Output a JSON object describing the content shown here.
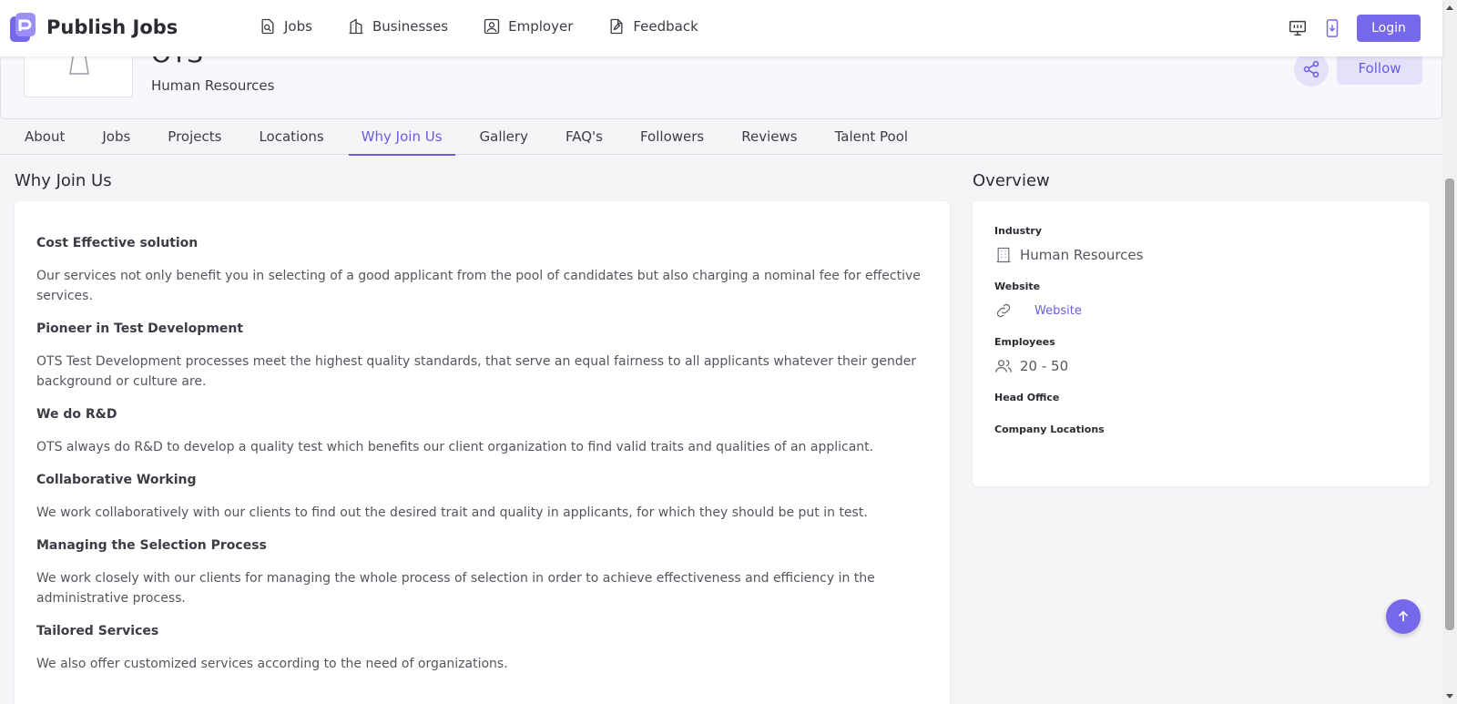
{
  "navbar": {
    "brand": "Publish Jobs",
    "links": [
      {
        "label": "Jobs",
        "icon": "job-search-icon"
      },
      {
        "label": "Businesses",
        "icon": "building-icon"
      },
      {
        "label": "Employer",
        "icon": "employer-icon"
      },
      {
        "label": "Feedback",
        "icon": "feedback-icon"
      }
    ],
    "icons": [
      "desktop-icon",
      "mobile-download-icon"
    ],
    "login_label": "Login"
  },
  "company": {
    "name": "OTS",
    "industry": "Human Resources",
    "follow_label": "Follow",
    "share_icon": "share-icon"
  },
  "tabs": [
    "About",
    "Jobs",
    "Projects",
    "Locations",
    "Why Join Us",
    "Gallery",
    "FAQ's",
    "Followers",
    "Reviews",
    "Talent Pool"
  ],
  "active_tab": "Why Join Us",
  "why_join": {
    "title": "Why Join Us",
    "items": [
      {
        "heading": "Cost Effective solution",
        "text": "Our services not only benefit you in selecting of a good applicant from the pool of candidates but also charging a nominal fee for effective services."
      },
      {
        "heading": "Pioneer in Test Development",
        "text": "OTS Test Development processes meet the highest quality standards, that serve an equal fairness to all applicants whatever their gender background or culture are."
      },
      {
        "heading": "We do R&D",
        "text": "OTS always do R&D to develop a quality test which benefits our client organization to find valid traits and qualities of an applicant."
      },
      {
        "heading": "Collaborative Working",
        "text": "We work collaboratively with our clients to find out the desired trait and quality in applicants, for which they should be put in test."
      },
      {
        "heading": "Managing the Selection Process",
        "text": "We work closely with our clients for managing the whole process of selection in order to achieve effectiveness and efficiency in the administrative process."
      },
      {
        "heading": "Tailored Services",
        "text": "We also offer customized services according to the need of organizations."
      }
    ]
  },
  "overview": {
    "title": "Overview",
    "industry_label": "Industry",
    "industry_value": "Human Resources",
    "website_label": "Website",
    "website_value": "Website",
    "employees_label": "Employees",
    "employees_value": "20 - 50",
    "head_office_label": "Head Office",
    "company_locations_label": "Company Locations"
  },
  "colors": {
    "accent": "#7568ea",
    "accent_light": "#e4e1fb",
    "logo_red": "#d8262c"
  }
}
